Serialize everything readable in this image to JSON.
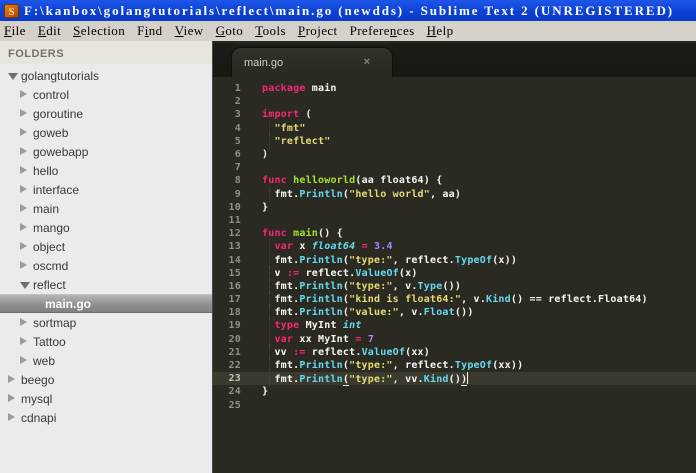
{
  "title_bar": {
    "icon": "sublime-text-icon",
    "icon_letter": "S",
    "title": "F:\\kanbox\\golangtutorials\\reflect\\main.go (newdds) - Sublime Text 2 (UNREGISTERED)"
  },
  "menu": {
    "items": [
      {
        "label": "File",
        "underline_index": 0
      },
      {
        "label": "Edit",
        "underline_index": 0
      },
      {
        "label": "Selection",
        "underline_index": 0
      },
      {
        "label": "Find",
        "underline_index": 1
      },
      {
        "label": "View",
        "underline_index": 0
      },
      {
        "label": "Goto",
        "underline_index": 0
      },
      {
        "label": "Tools",
        "underline_index": 0
      },
      {
        "label": "Project",
        "underline_index": 0
      },
      {
        "label": "Preferences",
        "underline_index": 7
      },
      {
        "label": "Help",
        "underline_index": 0
      }
    ]
  },
  "sidebar": {
    "header": "FOLDERS",
    "items": [
      {
        "label": "golangtutorials",
        "level": 0,
        "type": "folder",
        "state": "expanded",
        "selected": false
      },
      {
        "label": "control",
        "level": 1,
        "type": "folder",
        "state": "collapsed",
        "selected": false
      },
      {
        "label": "goroutine",
        "level": 1,
        "type": "folder",
        "state": "collapsed",
        "selected": false
      },
      {
        "label": "goweb",
        "level": 1,
        "type": "folder",
        "state": "collapsed",
        "selected": false
      },
      {
        "label": "gowebapp",
        "level": 1,
        "type": "folder",
        "state": "collapsed",
        "selected": false
      },
      {
        "label": "hello",
        "level": 1,
        "type": "folder",
        "state": "collapsed",
        "selected": false
      },
      {
        "label": "interface",
        "level": 1,
        "type": "folder",
        "state": "collapsed",
        "selected": false
      },
      {
        "label": "main",
        "level": 1,
        "type": "folder",
        "state": "collapsed",
        "selected": false
      },
      {
        "label": "mango",
        "level": 1,
        "type": "folder",
        "state": "collapsed",
        "selected": false
      },
      {
        "label": "object",
        "level": 1,
        "type": "folder",
        "state": "collapsed",
        "selected": false
      },
      {
        "label": "oscmd",
        "level": 1,
        "type": "folder",
        "state": "collapsed",
        "selected": false
      },
      {
        "label": "reflect",
        "level": 1,
        "type": "folder",
        "state": "expanded",
        "selected": false
      },
      {
        "label": "main.go",
        "level": 2,
        "type": "file",
        "state": "none",
        "selected": true
      },
      {
        "label": "sortmap",
        "level": 1,
        "type": "folder",
        "state": "collapsed",
        "selected": false
      },
      {
        "label": "Tattoo",
        "level": 1,
        "type": "folder",
        "state": "collapsed",
        "selected": false
      },
      {
        "label": "web",
        "level": 1,
        "type": "folder",
        "state": "collapsed",
        "selected": false
      },
      {
        "label": "beego",
        "level": 0,
        "type": "folder",
        "state": "collapsed",
        "selected": false
      },
      {
        "label": "mysql",
        "level": 0,
        "type": "folder",
        "state": "collapsed",
        "selected": false
      },
      {
        "label": "cdnapi",
        "level": 0,
        "type": "folder",
        "state": "collapsed",
        "selected": false
      }
    ]
  },
  "tabs": [
    {
      "label": "main.go",
      "close_glyph": "×",
      "active": true
    }
  ],
  "editor": {
    "current_line": 23,
    "cursor_line": 23,
    "token_styles": {
      "k": "keyword",
      "s": "string",
      "f": "function-name",
      "c": "function-call",
      "t": "type",
      "n": "number",
      "p": "plain",
      "u": "bracket-match"
    },
    "lines": [
      {
        "num": 1,
        "tokens": [
          [
            "k",
            "package"
          ],
          [
            "p",
            " main"
          ]
        ]
      },
      {
        "num": 2,
        "tokens": []
      },
      {
        "num": 3,
        "tokens": [
          [
            "k",
            "import"
          ],
          [
            "p",
            " ("
          ]
        ]
      },
      {
        "num": 4,
        "tokens": [
          [
            "p",
            "  "
          ],
          [
            "s",
            "\"fmt\""
          ]
        ]
      },
      {
        "num": 5,
        "tokens": [
          [
            "p",
            "  "
          ],
          [
            "s",
            "\"reflect\""
          ]
        ]
      },
      {
        "num": 6,
        "tokens": [
          [
            "p",
            ")"
          ]
        ]
      },
      {
        "num": 7,
        "tokens": []
      },
      {
        "num": 8,
        "tokens": [
          [
            "k",
            "func"
          ],
          [
            "p",
            " "
          ],
          [
            "f",
            "helloworld"
          ],
          [
            "p",
            "(aa float64) {"
          ]
        ]
      },
      {
        "num": 9,
        "tokens": [
          [
            "p",
            "  fmt."
          ],
          [
            "c",
            "Println"
          ],
          [
            "p",
            "("
          ],
          [
            "s",
            "\"hello world\""
          ],
          [
            "p",
            ", aa)"
          ]
        ]
      },
      {
        "num": 10,
        "tokens": [
          [
            "p",
            "}"
          ]
        ]
      },
      {
        "num": 11,
        "tokens": []
      },
      {
        "num": 12,
        "tokens": [
          [
            "k",
            "func"
          ],
          [
            "p",
            " "
          ],
          [
            "f",
            "main"
          ],
          [
            "p",
            "() {"
          ]
        ]
      },
      {
        "num": 13,
        "tokens": [
          [
            "p",
            "  "
          ],
          [
            "k",
            "var"
          ],
          [
            "p",
            " x "
          ],
          [
            "t",
            "float64"
          ],
          [
            "p",
            " "
          ],
          [
            "k",
            "="
          ],
          [
            "p",
            " "
          ],
          [
            "n",
            "3.4"
          ]
        ]
      },
      {
        "num": 14,
        "tokens": [
          [
            "p",
            "  fmt."
          ],
          [
            "c",
            "Println"
          ],
          [
            "p",
            "("
          ],
          [
            "s",
            "\"type:\""
          ],
          [
            "p",
            ", reflect."
          ],
          [
            "c",
            "TypeOf"
          ],
          [
            "p",
            "(x))"
          ]
        ]
      },
      {
        "num": 15,
        "tokens": [
          [
            "p",
            "  v "
          ],
          [
            "k",
            ":="
          ],
          [
            "p",
            " reflect."
          ],
          [
            "c",
            "ValueOf"
          ],
          [
            "p",
            "(x)"
          ]
        ]
      },
      {
        "num": 16,
        "tokens": [
          [
            "p",
            "  fmt."
          ],
          [
            "c",
            "Println"
          ],
          [
            "p",
            "("
          ],
          [
            "s",
            "\"type:\""
          ],
          [
            "p",
            ", v."
          ],
          [
            "c",
            "Type"
          ],
          [
            "p",
            "())"
          ]
        ]
      },
      {
        "num": 17,
        "tokens": [
          [
            "p",
            "  fmt."
          ],
          [
            "c",
            "Println"
          ],
          [
            "p",
            "("
          ],
          [
            "s",
            "\"kind is float64:\""
          ],
          [
            "p",
            ", v."
          ],
          [
            "c",
            "Kind"
          ],
          [
            "p",
            "() == reflect.Float64)"
          ]
        ]
      },
      {
        "num": 18,
        "tokens": [
          [
            "p",
            "  fmt."
          ],
          [
            "c",
            "Println"
          ],
          [
            "p",
            "("
          ],
          [
            "s",
            "\"value:\""
          ],
          [
            "p",
            ", v."
          ],
          [
            "c",
            "Float"
          ],
          [
            "p",
            "())"
          ]
        ]
      },
      {
        "num": 19,
        "tokens": [
          [
            "p",
            "  "
          ],
          [
            "k",
            "type"
          ],
          [
            "p",
            " MyInt "
          ],
          [
            "t",
            "int"
          ]
        ]
      },
      {
        "num": 20,
        "tokens": [
          [
            "p",
            "  "
          ],
          [
            "k",
            "var"
          ],
          [
            "p",
            " xx MyInt "
          ],
          [
            "k",
            "="
          ],
          [
            "p",
            " "
          ],
          [
            "n",
            "7"
          ]
        ]
      },
      {
        "num": 21,
        "tokens": [
          [
            "p",
            "  vv "
          ],
          [
            "k",
            ":="
          ],
          [
            "p",
            " reflect."
          ],
          [
            "c",
            "ValueOf"
          ],
          [
            "p",
            "(xx)"
          ]
        ]
      },
      {
        "num": 22,
        "tokens": [
          [
            "p",
            "  fmt."
          ],
          [
            "c",
            "Println"
          ],
          [
            "p",
            "("
          ],
          [
            "s",
            "\"type:\""
          ],
          [
            "p",
            ", reflect."
          ],
          [
            "c",
            "TypeOf"
          ],
          [
            "p",
            "(xx))"
          ]
        ]
      },
      {
        "num": 23,
        "tokens": [
          [
            "p",
            "  fmt."
          ],
          [
            "c",
            "Println"
          ],
          [
            "u",
            "("
          ],
          [
            "s",
            "\"type:\""
          ],
          [
            "p",
            ", vv."
          ],
          [
            "c",
            "Kind"
          ],
          [
            "p",
            "()"
          ],
          [
            "u",
            ")"
          ]
        ]
      },
      {
        "num": 24,
        "tokens": [
          [
            "p",
            "}"
          ]
        ]
      },
      {
        "num": 25,
        "tokens": []
      }
    ]
  },
  "colors": {
    "titlebar_blue": "#0d43d9",
    "menubar_bg": "#d5d1c8",
    "sidebar_bg": "#ebebeb",
    "editor_bg": "#2a2a23",
    "keyword": "#f92672",
    "string": "#e6db74",
    "function_name": "#a6e22e",
    "function_call": "#66d9ef",
    "type_italic": "#66d9ef",
    "number": "#ae81ff",
    "plain": "#f8f8f2",
    "line_number": "#90908a",
    "current_line_bg": "#3b3a2f"
  }
}
